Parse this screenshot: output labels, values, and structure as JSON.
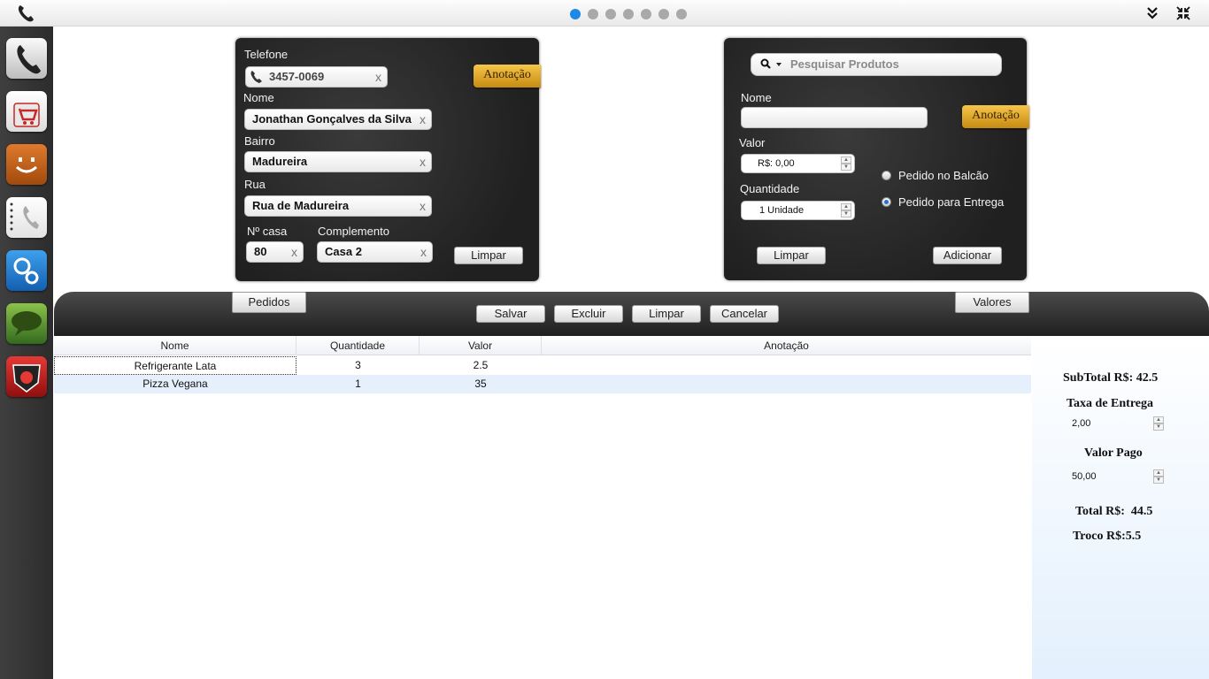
{
  "topbar": {
    "pages": [
      true,
      false,
      false,
      false,
      false,
      false,
      false
    ]
  },
  "dock": {
    "items": [
      "phone-app",
      "shopping-bag-app",
      "smiley-app",
      "phone-book-app",
      "settings-app",
      "chat-app",
      "pizzeria-app"
    ]
  },
  "customer": {
    "phone_label": "Telefone",
    "phone_value": "3457-0069",
    "name_label": "Nome",
    "name_value": "Jonathan Gonçalves da Silva",
    "district_label": "Bairro",
    "district_value": "Madureira",
    "street_label": "Rua",
    "street_value": "Rua de Madureira",
    "number_label": "Nº casa",
    "number_value": "80",
    "complement_label": "Complemento",
    "complement_value": "Casa 2",
    "clear_label": "Limpar",
    "note_tag": "Anotação",
    "clear_glyph": "x"
  },
  "product": {
    "search_placeholder": "Pesquisar Produtos",
    "name_label": "Nome",
    "name_value": "",
    "price_label": "Valor",
    "price_value": "R$: 0,00",
    "qty_label": "Quantidade",
    "qty_value": "1 Unidade",
    "note_tag": "Anotação",
    "radio_counter": "Pedido no Balcão",
    "radio_delivery": "Pedido para Entrega",
    "delivery_selected": true,
    "clear_label": "Limpar",
    "add_label": "Adicionar"
  },
  "toolbar": {
    "orders_tab": "Pedidos",
    "values_tab": "Valores",
    "save": "Salvar",
    "delete": "Excluir",
    "clear": "Limpar",
    "cancel": "Cancelar"
  },
  "table": {
    "columns": [
      "Nome",
      "Quantidade",
      "Valor",
      "Anotação"
    ],
    "rows": [
      [
        "Refrigerante Lata",
        "3",
        "2.5",
        ""
      ],
      [
        "Pizza Vegana",
        "1",
        "35",
        ""
      ]
    ]
  },
  "totals": {
    "subtotal": "SubTotal R$: 42.5",
    "delivery_fee_label": "Taxa de Entrega",
    "delivery_fee_value": "2,00",
    "paid_label": "Valor Pago",
    "paid_value": "50,00",
    "total": "Total R$:  44.5",
    "change": "Troco R$:5.5"
  },
  "colors": {
    "accent": "#1e88e5",
    "tag": "#e0a52a",
    "selected_row": "#e6f0fc"
  }
}
